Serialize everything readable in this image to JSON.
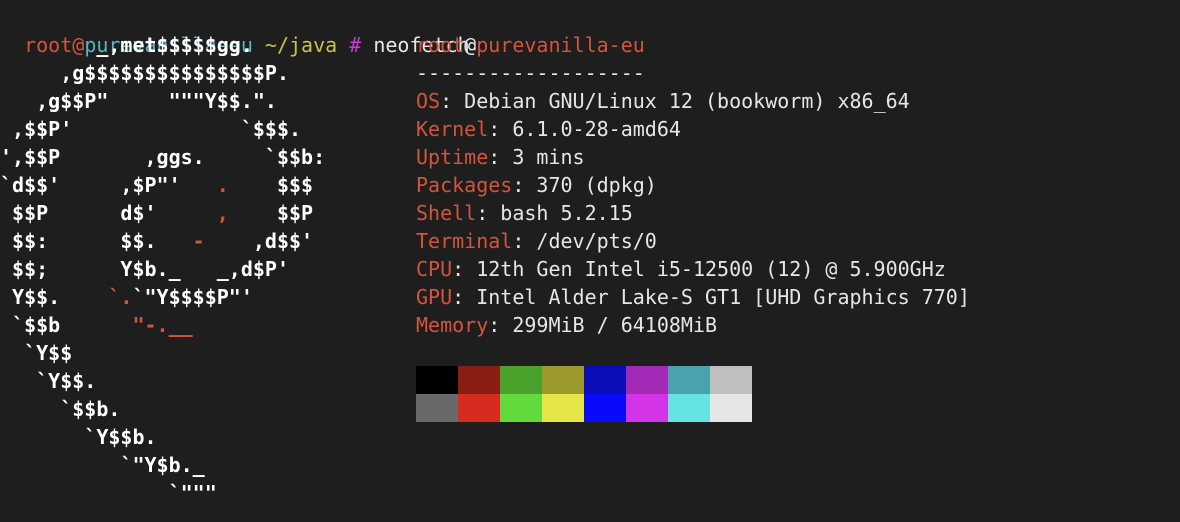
{
  "prompt": {
    "user": "root",
    "at": "@",
    "host": "purevanilla-eu",
    "path": " ~/java",
    "symbol": " #",
    "command": " neofetch"
  },
  "logo": [
    [
      "        _,met$$$$$gg.",
      "",
      ""
    ],
    [
      "     ,g$$$$$$$$$$$$$$$P.",
      "",
      ""
    ],
    [
      "   ,g$$P\"     \"\"\"Y$$.\".",
      "",
      ""
    ],
    [
      " ,$$P'              `$$$.",
      "",
      ""
    ],
    [
      "',$$P       ,ggs.     `$$b:",
      "",
      ""
    ],
    [
      "`d$$'     ,$P\"'   ",
      ".",
      "    $$$"
    ],
    [
      " $$P      d$'     ",
      ",",
      "    $$P"
    ],
    [
      " $$:      $$.   ",
      "-",
      "    ,d$$'"
    ],
    [
      " $$;      Y$b._   _,d$P'",
      "",
      ""
    ],
    [
      " Y$$.    ",
      "`.",
      "`\"Y$$$$P\"'"
    ],
    [
      " `$$b      ",
      "\"-.__",
      ""
    ],
    [
      "  `Y$$",
      "",
      ""
    ],
    [
      "   `Y$$.",
      "",
      ""
    ],
    [
      "     `$$b.",
      "",
      ""
    ],
    [
      "       `Y$$b.",
      "",
      ""
    ],
    [
      "          `\"Y$b._",
      "",
      ""
    ],
    [
      "              `\"\"\"",
      "",
      ""
    ]
  ],
  "info": {
    "title_user": "root",
    "title_at": "@",
    "title_host": "purevanilla-eu",
    "separator": "-------------------",
    "rows": [
      {
        "key": "OS",
        "value": ": Debian GNU/Linux 12 (bookworm) x86_64"
      },
      {
        "key": "Kernel",
        "value": ": 6.1.0-28-amd64"
      },
      {
        "key": "Uptime",
        "value": ": 3 mins"
      },
      {
        "key": "Packages",
        "value": ": 370 (dpkg)"
      },
      {
        "key": "Shell",
        "value": ": bash 5.2.15"
      },
      {
        "key": "Terminal",
        "value": ": /dev/pts/0"
      },
      {
        "key": "CPU",
        "value": ": 12th Gen Intel i5-12500 (12) @ 5.900GHz"
      },
      {
        "key": "GPU",
        "value": ": Intel Alder Lake-S GT1 [UHD Graphics 770]"
      },
      {
        "key": "Memory",
        "value": ": 299MiB / 64108MiB"
      }
    ]
  },
  "palette": {
    "normal": [
      "#000000",
      "#8b1c12",
      "#4aa22c",
      "#9c9a2c",
      "#0b0eb8",
      "#a22ab6",
      "#4aa1b0",
      "#bfbfbf"
    ],
    "bright": [
      "#686868",
      "#d52c1f",
      "#63da3c",
      "#e5e54a",
      "#0a0afb",
      "#d335e6",
      "#66e3e3",
      "#e6e6e6"
    ]
  }
}
